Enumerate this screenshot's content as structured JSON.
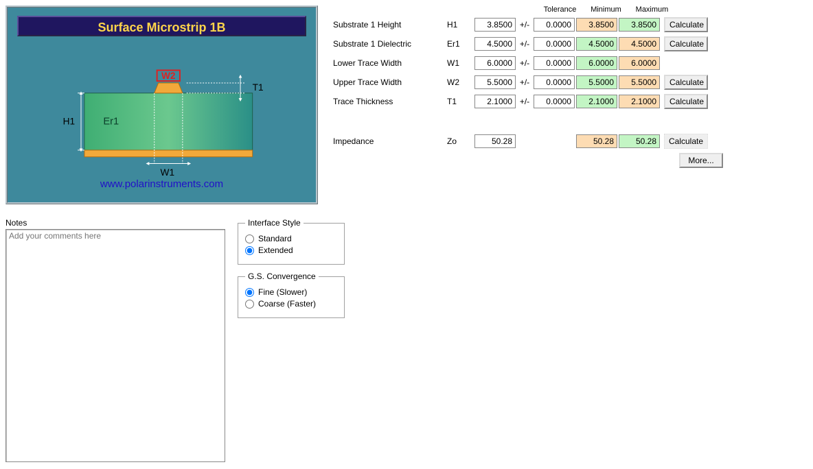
{
  "diagram": {
    "title": "Surface Microstrip 1B",
    "link": "www.polarinstruments.com",
    "labels": {
      "w2": "W2",
      "t1": "T1",
      "h1": "H1",
      "er1": "Er1",
      "w1": "W1"
    }
  },
  "headers": {
    "tolerance": "Tolerance",
    "minimum": "Minimum",
    "maximum": "Maximum"
  },
  "params": [
    {
      "label": "Substrate 1 Height",
      "sym": "H1",
      "val": "3.8500",
      "tol": "0.0000",
      "min": "3.8500",
      "max": "3.8500",
      "minCls": "cell-orange",
      "maxCls": "cell-green",
      "calc": true
    },
    {
      "label": "Substrate 1 Dielectric",
      "sym": "Er1",
      "val": "4.5000",
      "tol": "0.0000",
      "min": "4.5000",
      "max": "4.5000",
      "minCls": "cell-green",
      "maxCls": "cell-orange",
      "calc": true
    },
    {
      "label": "Lower Trace Width",
      "sym": "W1",
      "val": "6.0000",
      "tol": "0.0000",
      "min": "6.0000",
      "max": "6.0000",
      "minCls": "cell-green",
      "maxCls": "cell-orange",
      "calc": false
    },
    {
      "label": "Upper Trace Width",
      "sym": "W2",
      "val": "5.5000",
      "tol": "0.0000",
      "min": "5.5000",
      "max": "5.5000",
      "minCls": "cell-green",
      "maxCls": "cell-orange",
      "calc": true
    },
    {
      "label": "Trace Thickness",
      "sym": "T1",
      "val": "2.1000",
      "tol": "0.0000",
      "min": "2.1000",
      "max": "2.1000",
      "minCls": "cell-green",
      "maxCls": "cell-orange",
      "calc": true
    }
  ],
  "impedance": {
    "label": "Impedance",
    "sym": "Zo",
    "val": "50.28",
    "min": "50.28",
    "max": "50.28",
    "minCls": "cell-orange",
    "maxCls": "cell-green"
  },
  "buttons": {
    "calculate": "Calculate",
    "more": "More..."
  },
  "pm": "+/-",
  "notes": {
    "label": "Notes",
    "placeholder": "Add your comments here"
  },
  "interfaceStyle": {
    "legend": "Interface Style",
    "options": [
      "Standard",
      "Extended"
    ],
    "selected": "Extended"
  },
  "gsConvergence": {
    "legend": "G.S. Convergence",
    "options": [
      "Fine (Slower)",
      "Coarse (Faster)"
    ],
    "selected": "Fine (Slower)"
  }
}
